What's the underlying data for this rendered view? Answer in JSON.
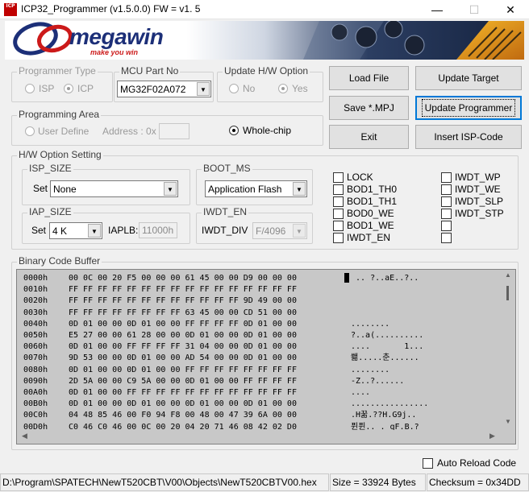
{
  "window": {
    "icon_text": "ICP",
    "title": "ICP32_Programmer (v1.5.0.0) FW = v1. 5",
    "minimize_glyph": "—",
    "maximize_glyph": "☐",
    "close_glyph": "✕"
  },
  "banner": {
    "brand": "megawin",
    "tagline": "make you win"
  },
  "programmer_type": {
    "label": "Programmer Type",
    "options": [
      "ISP",
      "ICP"
    ],
    "selected": "ICP"
  },
  "mcu_part": {
    "label": "MCU Part No",
    "value": "MG32F02A072"
  },
  "update_hw": {
    "label": "Update H/W Option",
    "options": [
      "No",
      "Yes"
    ],
    "selected": "Yes"
  },
  "buttons": {
    "load_file": "Load File",
    "update_target": "Update Target",
    "save_mpj": "Save *.MPJ",
    "update_programmer": "Update Programmer",
    "exit": "Exit",
    "insert_isp": "Insert ISP-Code"
  },
  "programming_area": {
    "label": "Programming Area",
    "user_define": "User Define",
    "address_label": "Address : 0x",
    "address_value": "",
    "whole_chip": "Whole-chip",
    "selected": "Whole-chip"
  },
  "hw_option": {
    "label": "H/W Option Setting",
    "isp_size": {
      "label": "ISP_SIZE",
      "set_label": "Set",
      "value": "None"
    },
    "boot_ms": {
      "label": "BOOT_MS",
      "value": "Application Flash"
    },
    "iap_size": {
      "label": "IAP_SIZE",
      "set_label": "Set",
      "value": "4 K",
      "iaplb_label": "IAPLB:",
      "iaplb_value": "11000h"
    },
    "iwdt_en": {
      "label": "IWDT_EN",
      "div_label": "IWDT_DIV",
      "div_value": "F/4096"
    },
    "checks_left": [
      "LOCK",
      "BOD1_TH0",
      "BOD1_TH1",
      "BOD0_WE",
      "BOD1_WE",
      "IWDT_EN"
    ],
    "checks_right": [
      "IWDT_WP",
      "IWDT_WE",
      "IWDT_SLP",
      "IWDT_STP",
      "",
      ""
    ]
  },
  "buffer": {
    "label": "Binary Code Buffer",
    "rows": [
      {
        "addr": "0000h",
        "bytes": "00 0C 00 20 F5 00 00 00 61 45 00 00 D9 00 00 00",
        "ascii": " .. ?..aE..?.."
      },
      {
        "addr": "0010h",
        "bytes": "FF FF FF FF FF FF FF FF FF FF FF FF FF FF FF FF",
        "ascii": ""
      },
      {
        "addr": "0020h",
        "bytes": "FF FF FF FF FF FF FF FF FF FF FF FF 9D 49 00 00",
        "ascii": ""
      },
      {
        "addr": "0030h",
        "bytes": "FF FF FF FF FF FF FF FF 63 45 00 00 CD 51 00 00",
        "ascii": ""
      },
      {
        "addr": "0040h",
        "bytes": "0D 01 00 00 0D 01 00 00 FF FF FF FF 0D 01 00 00",
        "ascii": "........"
      },
      {
        "addr": "0050h",
        "bytes": "E5 27 00 00 61 28 00 00 0D 01 00 00 0D 01 00 00",
        "ascii": "?..a(.........."
      },
      {
        "addr": "0060h",
        "bytes": "0D 01 00 00 FF FF FF FF 31 04 00 00 0D 01 00 00",
        "ascii": "....       1..."
      },
      {
        "addr": "0070h",
        "bytes": "9D 53 00 00 0D 01 00 00 AD 54 00 00 0D 01 00 00",
        "ascii": "쐚.....춘......"
      },
      {
        "addr": "0080h",
        "bytes": "0D 01 00 00 0D 01 00 00 FF FF FF FF FF FF FF FF",
        "ascii": "........"
      },
      {
        "addr": "0090h",
        "bytes": "2D 5A 00 00 C9 5A 00 00 0D 01 00 00 FF FF FF FF",
        "ascii": "-Z..?......"
      },
      {
        "addr": "00A0h",
        "bytes": "0D 01 00 00 FF FF FF FF FF FF FF FF FF FF FF FF",
        "ascii": "...."
      },
      {
        "addr": "00B0h",
        "bytes": "0D 01 00 00 0D 01 00 00 0D 01 00 00 0D 01 00 00",
        "ascii": "................"
      },
      {
        "addr": "00C0h",
        "bytes": "04 48 85 46 00 F0 94 F8 00 48 00 47 39 6A 00 00",
        "ascii": ".H꿂.??H.G9j.."
      },
      {
        "addr": "00D0h",
        "bytes": "C0 46 C0 46 00 0C 00 20 04 20 71 46 08 42 02 D0",
        "ascii": "퓐퓐.. . qF.B.?"
      }
    ]
  },
  "auto_reload": {
    "label": "Auto Reload Code",
    "checked": false
  },
  "status": {
    "path": "D:\\Program\\SPATECH\\NewT520CBT\\V00\\Objects\\NewT520CBTV00.hex",
    "size": "Size = 33924 Bytes",
    "checksum": "Checksum = 0x34DD"
  }
}
